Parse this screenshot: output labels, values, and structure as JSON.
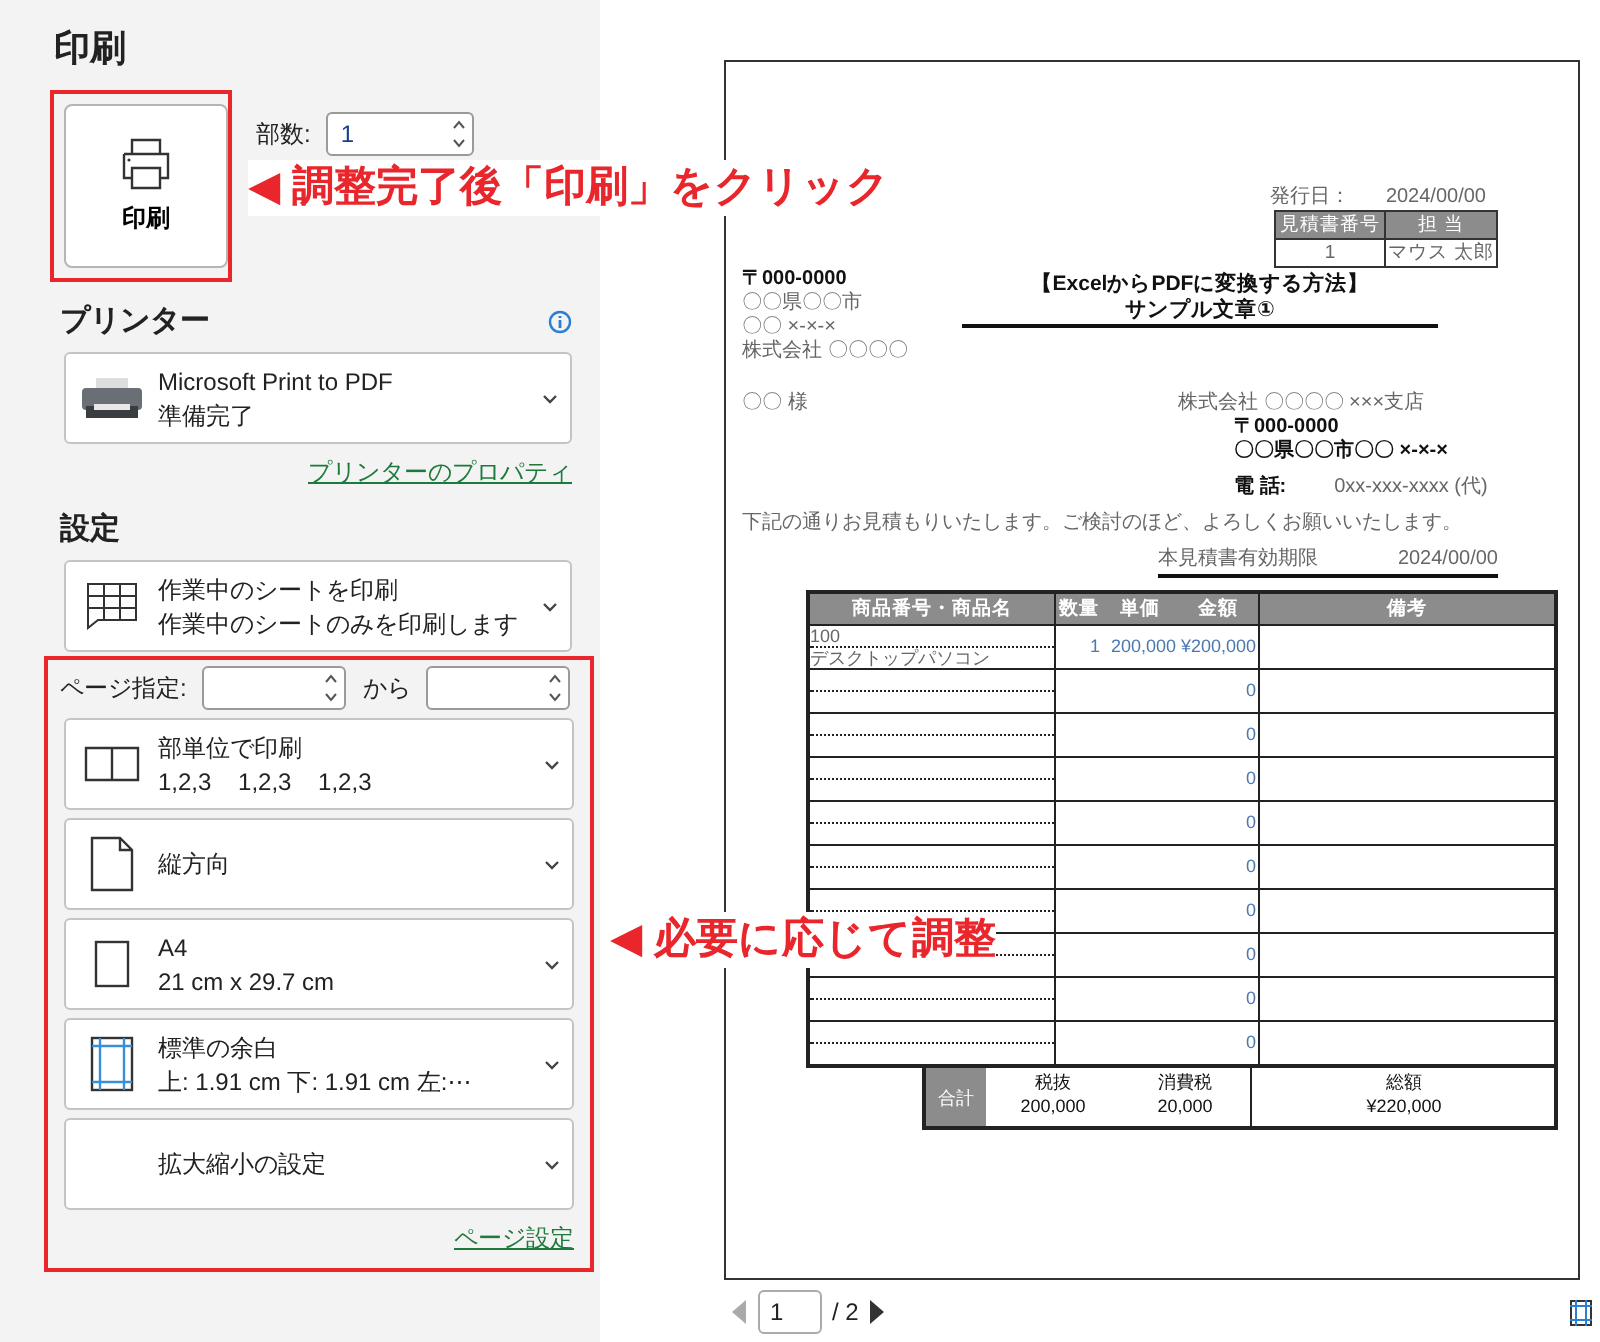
{
  "title": "印刷",
  "print_button": {
    "label": "印刷"
  },
  "copies": {
    "label": "部数:",
    "value": "1"
  },
  "printer": {
    "heading": "プリンター",
    "name": "Microsoft Print to PDF",
    "status": "準備完了",
    "properties_link": "プリンターのプロパティ"
  },
  "settings": {
    "heading": "設定",
    "scope": {
      "kind": "sheet",
      "line1": "作業中のシートを印刷",
      "line2": "作業中のシートのみを印刷します"
    },
    "page_range": {
      "label": "ページ指定:",
      "to_label": "から"
    },
    "options": [
      {
        "kind": "collate",
        "line1": "部単位で印刷",
        "line2": "1,2,3    1,2,3    1,2,3"
      },
      {
        "kind": "orientation",
        "line1": "縦方向"
      },
      {
        "kind": "paper",
        "line1": "A4",
        "line2": "21 cm x 29.7 cm"
      },
      {
        "kind": "margins",
        "line1": "標準の余白",
        "line2": "上: 1.91 cm 下: 1.91 cm 左:⋯"
      },
      {
        "kind": "scaling",
        "line1": "拡大縮小の設定"
      }
    ],
    "page_setup_link": "ページ設定"
  },
  "document": {
    "issue_date_label": "発行日：",
    "issue_date": "2024/00/00",
    "ref_table": {
      "headers": [
        "見積書番号",
        "担 当"
      ],
      "values": [
        "1",
        "マウス 太郎"
      ]
    },
    "recipient": [
      "〒000-0000",
      "〇〇県〇〇市",
      "〇〇 ×-×-×",
      "株式会社 〇〇〇〇"
    ],
    "title": [
      "【ExcelからPDFに変換する方法】",
      "サンプル文章①"
    ],
    "addressee": "〇〇 様",
    "sender": [
      "株式会社 〇〇〇〇 ×××支店",
      "〒000-0000",
      "〇〇県〇〇市〇〇 ×-×-×"
    ],
    "phone_label": "電 話:",
    "phone": "0xx-xxx-xxxx (代)",
    "message": "下記の通りお見積もりいたします。ご検討のほど、よろしくお願いいたします。",
    "validity_label": "本見積書有効期限",
    "validity": "2024/00/00",
    "columns": [
      "商品番号・商品名",
      "数量",
      "単価",
      "金額",
      "備考"
    ],
    "rows": [
      {
        "code": "100",
        "name": "デスクトップパソコン",
        "qty": "1",
        "price": "200,000",
        "amount": "¥200,000"
      },
      {
        "amount": "0"
      },
      {
        "amount": "0"
      },
      {
        "amount": "0"
      },
      {
        "amount": "0"
      },
      {
        "amount": "0"
      },
      {
        "amount": "0"
      },
      {
        "amount": "0"
      },
      {
        "amount": "0"
      },
      {
        "amount": "0"
      }
    ],
    "total_label": "合計",
    "totals": [
      {
        "label": "税抜",
        "value": "200,000"
      },
      {
        "label": "消費税",
        "value": "20,000"
      },
      {
        "label": "総額",
        "value": "¥220,000"
      }
    ]
  },
  "nav": {
    "page": "1",
    "total": "/ 2"
  },
  "annotations": [
    {
      "text": "◀ 調整完了後「印刷」をクリック"
    },
    {
      "text": "◀ 必要に応じて調整"
    }
  ]
}
